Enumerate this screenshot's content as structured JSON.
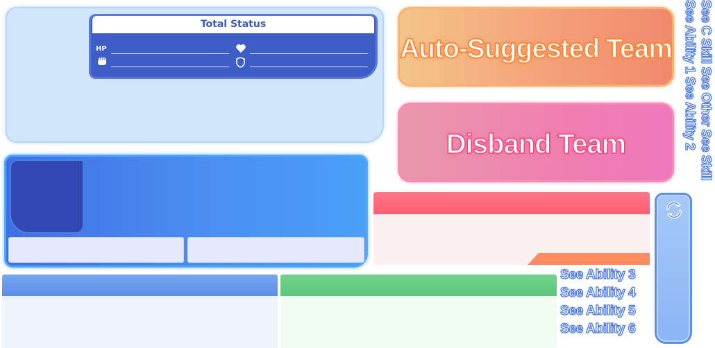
{
  "status_panel": {
    "title": "Total Status",
    "hp_label": "HP",
    "icons": [
      "heart-icon",
      "fist-icon",
      "shield-icon"
    ]
  },
  "buttons": {
    "auto_suggest": "Auto-Suggested Team",
    "disband": "Disband Team"
  },
  "side_labels": [
    "See Skill",
    "See Other",
    "See C Skill",
    "See Ability 2",
    "See Ability 1"
  ],
  "ability_labels": [
    "See Ability 3",
    "See Ability 4",
    "See Ability 5",
    "See Ability 6"
  ],
  "refresh_icon": "refresh-icon",
  "colors": {
    "panel_light": "#d2e6fb",
    "status_blue": "#3d5ec6",
    "auto_btn": "#f5a079",
    "disband_btn": "#ef7fb0",
    "pink_header": "#ff5d74",
    "green_header": "#5bc67b",
    "blue_header": "#5b8de6"
  }
}
